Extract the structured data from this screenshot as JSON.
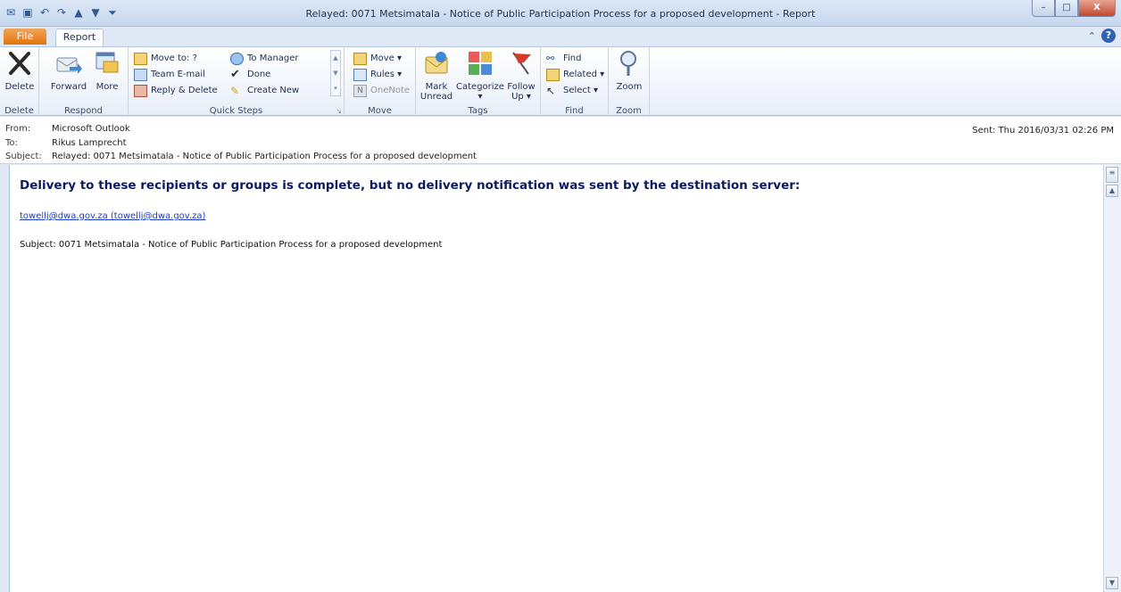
{
  "window": {
    "title": "Relayed: 0071 Metsimatala - Notice of Public Participation Process for a proposed development - Report",
    "min_glyph": "–",
    "max_glyph": "□",
    "close_glyph": "X"
  },
  "tabs": {
    "file": "File",
    "report": "Report",
    "help": "?"
  },
  "ribbon": {
    "delete": {
      "btn": "Delete",
      "group": "Delete"
    },
    "respond": {
      "forward": "Forward",
      "more": "More",
      "group": "Respond"
    },
    "quick_steps": {
      "items": [
        "Move to: ?",
        "Team E-mail",
        "Reply & Delete",
        "To Manager",
        "Done",
        "Create New"
      ],
      "group": "Quick Steps"
    },
    "move": {
      "move": "Move ▾",
      "rules": "Rules ▾",
      "onenote": "OneNote",
      "group": "Move"
    },
    "tags": {
      "mark_unread_1": "Mark",
      "mark_unread_2": "Unread",
      "categorize": "Categorize",
      "follow_up_1": "Follow",
      "follow_up_2": "Up ▾",
      "group": "Tags"
    },
    "find": {
      "find": "Find",
      "related": "Related ▾",
      "select": "Select ▾",
      "group": "Find"
    },
    "zoom": {
      "btn": "Zoom",
      "group": "Zoom"
    }
  },
  "header": {
    "from_label": "From:",
    "from": "Microsoft Outlook",
    "to_label": "To:",
    "to": "Rikus Lamprecht",
    "subject_label": "Subject:",
    "subject": "Relayed: 0071 Metsimatala - Notice of Public Participation Process for a proposed development",
    "sent_label": "Sent:",
    "sent": "Thu 2016/03/31 02:26 PM"
  },
  "body": {
    "heading": "Delivery to these recipients or groups is complete, but no delivery notification was sent by the destination server:",
    "recipient": "towellj@dwa.gov.za (towellj@dwa.gov.za)",
    "subject_line": "Subject: 0071 Metsimatala - Notice of Public Participation Process for a proposed development"
  }
}
